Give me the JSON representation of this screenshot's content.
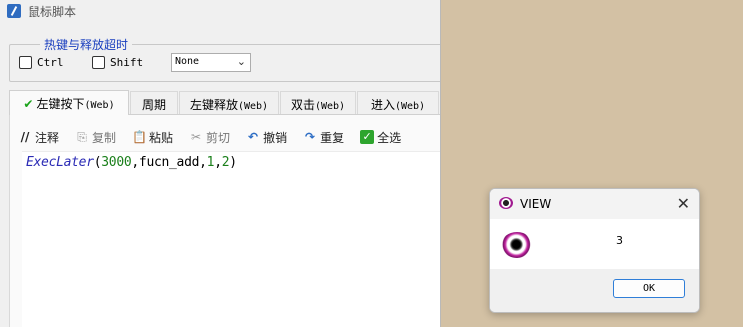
{
  "window": {
    "title": "鼠标脚本"
  },
  "hotkey_group": {
    "legend": "热键与释放超时",
    "ctrl_label": "Ctrl",
    "shift_label": "Shift",
    "select_value": "None"
  },
  "tabs": [
    {
      "label": "左键按下",
      "suffix": "(Web)"
    },
    {
      "label": "周期",
      "suffix": ""
    },
    {
      "label": "左键释放",
      "suffix": "(Web)"
    },
    {
      "label": "双击",
      "suffix": "(Web)"
    },
    {
      "label": "进入",
      "suffix": "(Web)"
    }
  ],
  "toolbar": {
    "comment": "注释",
    "copy": "复制",
    "paste": "粘贴",
    "cut": "剪切",
    "undo": "撤销",
    "redo": "重复",
    "select_all": "全选"
  },
  "editor": {
    "func": "ExecLater",
    "open": "(",
    "arg1": "3000",
    "mid": ",fucn_add,",
    "arg2": "1",
    "comma": ",",
    "arg3": "2",
    "close": ")"
  },
  "dialog": {
    "title": "VIEW",
    "message": "3",
    "ok_label": "OK"
  },
  "colors": {
    "desktop": "#d3c1a4",
    "accent": "#2f7ed8",
    "legend_text": "#1a3fbf"
  }
}
